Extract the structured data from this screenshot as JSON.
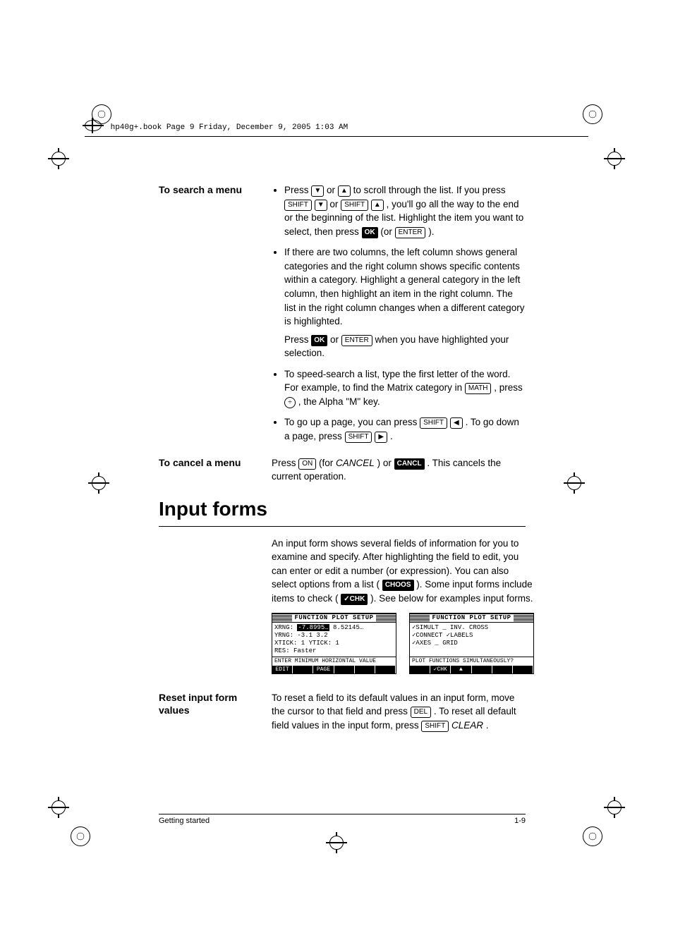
{
  "header_text": "hp40g+.book  Page 9  Friday, December 9, 2005  1:03 AM",
  "side": {
    "search": "To search a menu",
    "cancel": "To cancel a menu",
    "reset": "Reset input form values"
  },
  "keys": {
    "shift": "SHIFT",
    "enter": "ENTER",
    "ok": "OK",
    "cancl": "CANCL",
    "choos": "CHOOS",
    "chk": "✓CHK",
    "math": "MATH",
    "del": "DEL",
    "on": "ON",
    "clear": "CLEAR",
    "cancel_italic": "CANCEL",
    "divide": "÷",
    "up": "▲",
    "down": "▼",
    "left": "◀",
    "right": "▶"
  },
  "bullets": {
    "b1a": "Press ",
    "b1b": " or ",
    "b1c": " to scroll through the list. If you press ",
    "b1d": " or ",
    "b1e": " , you'll go all the way to the end or the beginning of the list. Highlight the item you want to select, then press ",
    "b1f": " (or ",
    "b1g": ").",
    "b2": "If there are two columns, the left column shows general categories and the right column shows specific contents within a category. Highlight a general category in the left column, then highlight an item in the right column. The list in the right column changes when a different category is highlighted.",
    "b2p_a": "Press ",
    "b2p_b": " or ",
    "b2p_c": " when you have highlighted your selection.",
    "b3a": "To speed-search a list, type the first letter of the word. For example, to find the Matrix category in ",
    "b3b": ", press ",
    "b3c": ", the Alpha \"M\" key.",
    "b4a": "To go up a page, you can press ",
    "b4b": " . To go down a page, press ",
    "b4c": "."
  },
  "cancel": {
    "a": "Press ",
    "b": " (for ",
    "c": ") or ",
    "d": ". This cancels the current operation."
  },
  "input_heading": "Input forms",
  "input_para_a": "An input form shows several fields of information for you to examine and specify. After highlighting the field to edit, you can enter or edit a number (or expression). You can also select options from a list (",
  "input_para_b": "). Some input forms include items to check (",
  "input_para_c": "). See below for examples input forms.",
  "screens": {
    "title": "FUNCTION PLOT SETUP",
    "left": {
      "l1a": "XRNG:",
      "l1b": "-7.8995…",
      "l1c": "8.52145…",
      "l2": "YRNG: -3.1       3.2",
      "l3": "XTICK: 1     YTICK: 1",
      "l4": "RES:  Faster",
      "hint": "ENTER MINIMUM HORIZONTAL VALUE",
      "menu": [
        "EDIT",
        "",
        "PAGE ▼",
        "",
        "",
        ""
      ]
    },
    "right": {
      "r1": "✓SIMULT       _ INV. CROSS",
      "r2": "✓CONNECT      ✓LABELS",
      "r3": "✓AXES         _ GRID",
      "hint": "PLOT FUNCTIONS SIMULTANEOUSLY?",
      "menu": [
        "",
        "✓CHK",
        "▲ PAGE",
        "",
        "",
        ""
      ]
    }
  },
  "reset": {
    "a": "To reset a field to its default values in an input form, move the cursor to that field and press ",
    "b": ". To reset all default field values in the input form, press ",
    "c": "."
  },
  "footer": {
    "left": "Getting started",
    "right": "1-9"
  }
}
